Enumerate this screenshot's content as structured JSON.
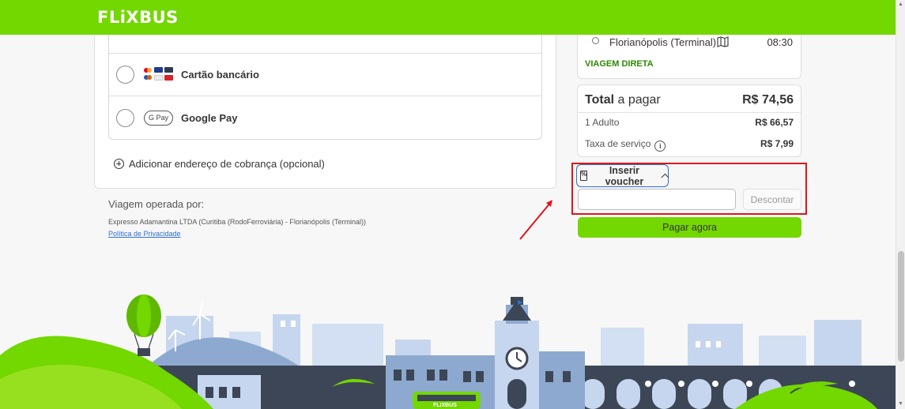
{
  "header": {
    "logo": "FLiXBUS"
  },
  "payment": {
    "methods": [
      {
        "label": "Cartão bancário",
        "icon": "credit-cards-icon"
      },
      {
        "label": "Google Pay",
        "icon": "google-pay-icon",
        "badge": "G Pay"
      }
    ],
    "billing_address_label": "Adicionar endereço de cobrança (opcional)"
  },
  "operator": {
    "title": "Viagem operada por:",
    "text": "Expresso Adamantina LTDA (Curitiba (RodoFerroviária) - Florianópolis (Terminal))",
    "privacy_link": "Política de Privacidade"
  },
  "trip": {
    "stop_name": "Florianópolis (Terminal)",
    "stop_time": "08:30",
    "direct_label": "VIAGEM DIRETA"
  },
  "summary": {
    "total_label_bold": "Total",
    "total_label_rest": " a pagar",
    "total_value": "R$ 74,56",
    "lines": [
      {
        "label": "1 Adulto",
        "value": "R$ 66,57"
      },
      {
        "label": "Taxa de serviço",
        "value": "R$ 7,99"
      }
    ]
  },
  "voucher": {
    "toggle_label": "Inserir voucher",
    "input_value": "",
    "discount_label": "Descontar"
  },
  "pay_now_label": "Pagar agora",
  "illustration": {
    "bus_label": "FLIXBUS"
  },
  "colors": {
    "brand": "#73d700",
    "annotation": "#e0141a",
    "focus": "#2f6fd1",
    "direct": "#2b8a00"
  }
}
